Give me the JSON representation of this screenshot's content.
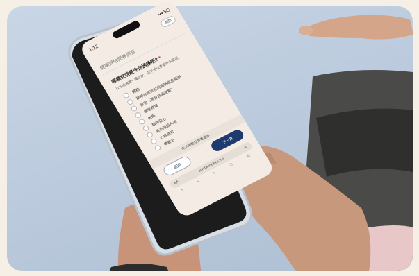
{
  "phone": {
    "time": "1:12",
    "signal": "••• 5G",
    "close_label": "關閉"
  },
  "survey": {
    "title": "健康評估問卷調查",
    "question": "哪種症狀最令你困擾呢?",
    "required_mark": "*",
    "hint": "以下請選擇一種症狀，向下滑以查看更多選項。",
    "options": [
      {
        "label": "轉精"
      },
      {
        "label": "精神診想流包到稇冊刷息騒潮"
      },
      {
        "label": "疲累（適合自我復累）"
      },
      {
        "label": "慢性疼痛"
      },
      {
        "label": "失眠"
      },
      {
        "label": "精神惡心"
      },
      {
        "label": "氣血虺設水滳"
      },
      {
        "label": "心跳急犹"
      },
      {
        "label": "傳異志"
      }
    ],
    "scroll_hint": "向下滑動以查看更多 ↓",
    "prev_label": "返回",
    "next_label": "下一頁"
  },
  "browser": {
    "aa_label": "AA",
    "url": "ech.tawneleos.me/",
    "reload_icon": "reload-icon",
    "toolbar": [
      "‹",
      "›",
      "↑",
      "□",
      "⧉"
    ]
  },
  "colors": {
    "background": "#c9d6e6",
    "phone_frame": "#dde3ea",
    "next_button": "#1e3a6e",
    "screen": "#f4ece4"
  }
}
